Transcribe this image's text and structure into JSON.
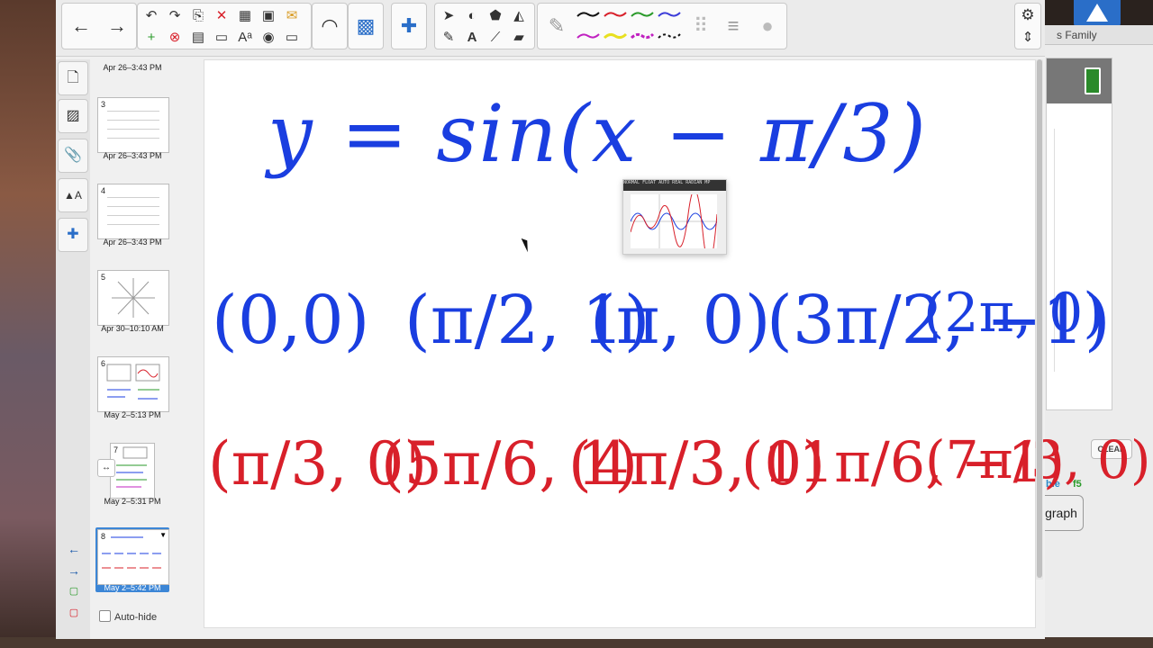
{
  "background_window": {
    "title": "s Family",
    "clear_label": "CLEAR",
    "label_fragment": "ble",
    "key_label": "f5",
    "graph_button": "graph"
  },
  "toolbar": {
    "icons": {
      "back": "arrow-left-icon",
      "forward": "arrow-right-icon",
      "undo": "undo-icon",
      "redo": "redo-icon",
      "delete": "delete-icon",
      "table": "table-icon",
      "screen": "screen-shade-icon",
      "select": "select-arrow-icon",
      "text": "text-icon",
      "eraser": "eraser-icon",
      "settings": "gear-icon"
    },
    "text_tool": "A",
    "pen_colors": [
      "#111111",
      "#d8202a",
      "#2a9a2a",
      "#3c3cd8",
      "#c020c0",
      "#e8e020",
      "#c020c0",
      "#111111"
    ]
  },
  "sidebar": {
    "tabs": [
      "page-sorter",
      "gallery",
      "attachments",
      "properties",
      "add-ons"
    ]
  },
  "pages": [
    {
      "num": "",
      "date": "Apr 26–3:43 PM"
    },
    {
      "num": "3",
      "date": "Apr 26–3:43 PM"
    },
    {
      "num": "4",
      "date": "Apr 26–3:43 PM"
    },
    {
      "num": "5",
      "date": "Apr 30–10:10 AM"
    },
    {
      "num": "6",
      "date": "May 2–5:13 PM"
    },
    {
      "num": "7",
      "date": "May 2–5:31 PM"
    },
    {
      "num": "8",
      "date": "May 2–5:42 PM"
    }
  ],
  "autohide_label": "Auto-hide",
  "canvas": {
    "equation": "y = sin(x − π/3)",
    "blue_points": [
      "(0,0)",
      "(π/2, 1)",
      "(π, 0)",
      "(3π/2, −1)",
      "(2π, 0)"
    ],
    "red_points": [
      "(π/3, 0)",
      "(5π/6, 1)",
      "(4π/3, 0)",
      "(11π/6, −1)",
      "(7π/3, 0)"
    ],
    "calc_header": "NORMAL FLOAT AUTO REAL RADIAN MP"
  },
  "colors": {
    "blue_ink": "#1a3ee0",
    "red_ink": "#d8202a",
    "selection": "#3c86d6"
  }
}
